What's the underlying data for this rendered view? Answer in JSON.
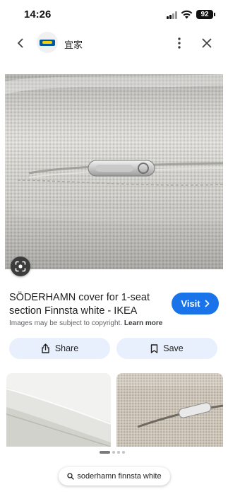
{
  "status_bar": {
    "time": "14:26",
    "battery": "92"
  },
  "header": {
    "site_name": "宜家"
  },
  "result": {
    "title": "SÖDERHAMN cover for 1-seat section Finnsta white - IKEA",
    "visit_label": "Visit",
    "copyright_prefix": "Images may be subject to copyright.",
    "learn_more": "Learn more"
  },
  "actions": {
    "share_label": "Share",
    "save_label": "Save"
  },
  "pagination": {
    "total": 4,
    "current": 1
  },
  "search_chip": {
    "query": "soderhamn finnsta white"
  },
  "colors": {
    "accent": "#1a73e8",
    "chip_bg": "#e8f0fe",
    "ikea_blue": "#0058a3",
    "ikea_yellow": "#ffcc00"
  },
  "icons": [
    "signal-icon",
    "wifi-icon",
    "battery-icon",
    "back-arrow-icon",
    "ikea-logo",
    "more-vert-icon",
    "close-icon",
    "lens-icon",
    "chevron-right-icon",
    "share-icon",
    "bookmark-icon",
    "search-icon"
  ]
}
